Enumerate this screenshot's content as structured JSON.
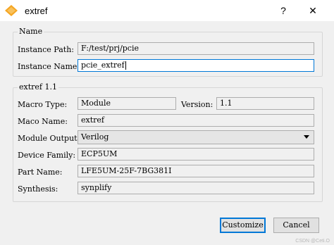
{
  "window": {
    "title": "extref",
    "help_glyph": "?",
    "close_glyph": "✕",
    "app_icon": "diamond-app-icon"
  },
  "name_group": {
    "title": "Name",
    "instance_path_label": "Instance Path:",
    "instance_path_value": "F:/test/prj/pcie",
    "instance_name_label": "Instance Name:",
    "instance_name_value": "pcie_extref"
  },
  "extref_group": {
    "title": "extref 1.1",
    "macro_type_label": "Macro Type:",
    "macro_type_value": "Module",
    "version_label": "Version:",
    "version_value": "1.1",
    "maco_name_label": "Maco Name:",
    "maco_name_value": "extref",
    "module_output_label": "Module Output:",
    "module_output_value": "Verilog",
    "device_family_label": "Device Family:",
    "device_family_value": "ECP5UM",
    "part_name_label": "Part Name:",
    "part_name_value": "LFE5UM-25F-7BG381I",
    "synthesis_label": "Synthesis:",
    "synthesis_value": "synplify"
  },
  "buttons": {
    "customize": "Customize",
    "cancel": "Cancel"
  },
  "watermark": "CSDN @Ceti.O"
}
